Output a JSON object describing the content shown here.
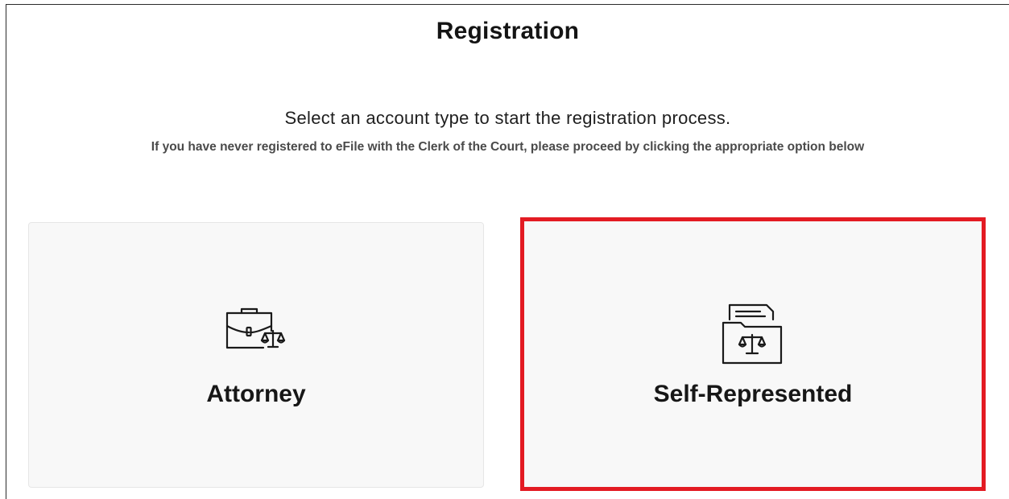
{
  "page": {
    "title": "Registration",
    "subtitle": "Select an account type to start the registration process.",
    "instruction": "If you have never registered to eFile with the Clerk of the Court, please proceed by clicking the appropriate option below"
  },
  "options": [
    {
      "label": "Attorney",
      "icon": "briefcase-scales-icon",
      "selected": false
    },
    {
      "label": "Self-Represented",
      "icon": "folder-scales-icon",
      "selected": true
    }
  ],
  "colors": {
    "highlight": "#e31b23",
    "card_background": "#f8f8f8",
    "text": "#171717",
    "muted_text": "#4a4a4a"
  }
}
